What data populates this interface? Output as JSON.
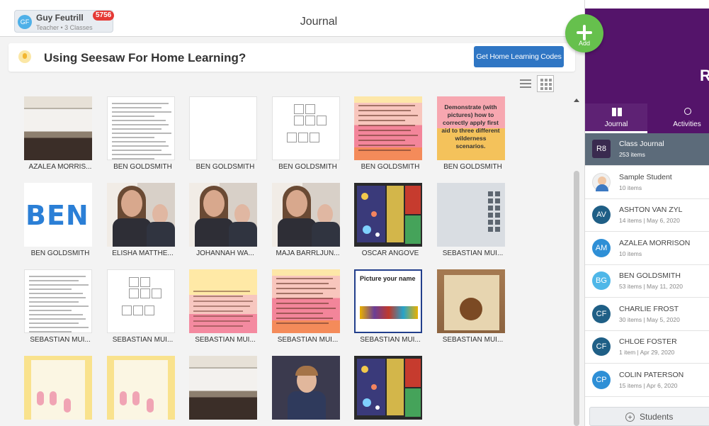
{
  "header": {
    "user": {
      "initials": "GF",
      "name": "Guy Feutrill",
      "role": "Teacher • 3 Classes"
    },
    "notifications": "5756",
    "title": "Journal",
    "add_label": "Add"
  },
  "banner": {
    "text": "Using Seesaw For Home Learning?",
    "button": "Get Home Learning Codes"
  },
  "feed": [
    {
      "caption": "AZALEA MORRIS...",
      "thumb": "photo-class"
    },
    {
      "caption": "BEN GOLDSMITH",
      "thumb": "doc"
    },
    {
      "caption": "BEN GOLDSMITH",
      "thumb": "doc-blank"
    },
    {
      "caption": "BEN GOLDSMITH",
      "thumb": "worksheet"
    },
    {
      "caption": "BEN GOLDSMITH",
      "thumb": "pink-text"
    },
    {
      "caption": "BEN GOLDSMITH",
      "thumb": "first-aid"
    },
    {
      "caption": "BEN GOLDSMITH",
      "thumb": "ben"
    },
    {
      "caption": "ELISHA MATTHE...",
      "thumb": "girl"
    },
    {
      "caption": "JOHANNAH WA...",
      "thumb": "girl"
    },
    {
      "caption": "MAJA BARRLJUN...",
      "thumb": "girl"
    },
    {
      "caption": "OSCAR ANGOVE",
      "thumb": "space"
    },
    {
      "caption": "SEBASTIAN MUI...",
      "thumb": "tablet"
    },
    {
      "caption": "SEBASTIAN MUI...",
      "thumb": "doc"
    },
    {
      "caption": "SEBASTIAN MUI...",
      "thumb": "worksheet"
    },
    {
      "caption": "SEBASTIAN MUI...",
      "thumb": "yellow-pink"
    },
    {
      "caption": "SEBASTIAN MUI...",
      "thumb": "pink-text"
    },
    {
      "caption": "SEBASTIAN MUI...",
      "thumb": "picture-name"
    },
    {
      "caption": "SEBASTIAN MUI...",
      "thumb": "wood"
    },
    {
      "caption": "",
      "thumb": "flamingo"
    },
    {
      "caption": "",
      "thumb": "flamingo"
    },
    {
      "caption": "",
      "thumb": "photo-class"
    },
    {
      "caption": "",
      "thumb": "boy"
    },
    {
      "caption": "",
      "thumb": "space"
    }
  ],
  "thumb_text": {
    "first_aid": "Demonstrate (with pictures) how to correctly apply first aid to three different wilderness scenarios.",
    "picture_title": "Picture your name",
    "ben": "BEN"
  },
  "sidebar": {
    "header_initial": "R",
    "tabs": [
      {
        "label": "Journal",
        "icon": "book-icon",
        "active": true
      },
      {
        "label": "Activities",
        "icon": "lightbulb-icon",
        "active": false
      }
    ],
    "items": [
      {
        "initials": "R8",
        "name": "Class Journal",
        "sub": "253 items",
        "color": "#3a2a4f",
        "active": true
      },
      {
        "initials": "",
        "name": "Sample Student",
        "sub": "10 items",
        "color": "#f0f0f0",
        "active": false
      },
      {
        "initials": "AV",
        "name": "ASHTON VAN ZYL",
        "sub": "14 items | May 6, 2020",
        "color": "#1f5f86",
        "active": false
      },
      {
        "initials": "AM",
        "name": "AZALEA MORRISON",
        "sub": "10 items",
        "color": "#2e8fd6",
        "active": false
      },
      {
        "initials": "BG",
        "name": "BEN GOLDSMITH",
        "sub": "53 items | May 11, 2020",
        "color": "#4fb7e8",
        "active": false
      },
      {
        "initials": "CF",
        "name": "CHARLIE FROST",
        "sub": "30 items | May 5, 2020",
        "color": "#1f5f86",
        "active": false
      },
      {
        "initials": "CF",
        "name": "CHLOE FOSTER",
        "sub": "1 item | Apr 29, 2020",
        "color": "#1f5f86",
        "active": false
      },
      {
        "initials": "CP",
        "name": "COLIN PATERSON",
        "sub": "15 items | Apr 6, 2020",
        "color": "#2e8fd6",
        "active": false
      }
    ],
    "students_button": "Students"
  },
  "colors": {
    "accent_green": "#66c04d",
    "class_purple": "#54146a",
    "button_blue": "#2f76c4"
  }
}
